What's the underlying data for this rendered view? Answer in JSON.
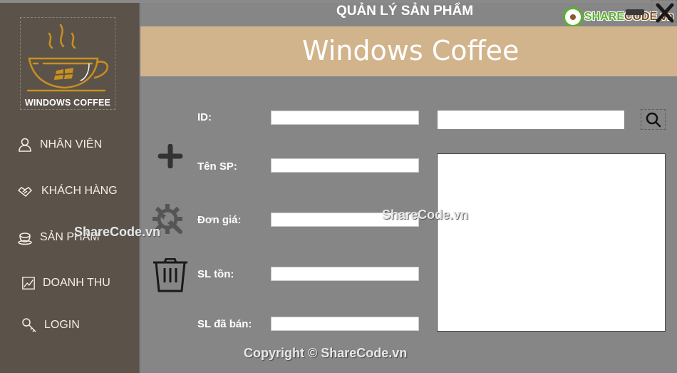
{
  "window": {
    "title": "QUẢN LÝ SẢN PHẨM",
    "minimize_icon": "minimize-icon",
    "close_icon": "close-icon"
  },
  "brand_watermark": {
    "share": "SHARE",
    "code": "CODE.vn"
  },
  "sidebar": {
    "logo_text": "WINDOWS COFFEE",
    "items": [
      {
        "label": "NHÂN VIÊN",
        "icon": "user-icon"
      },
      {
        "label": "KHÁCH HÀNG",
        "icon": "handshake-icon"
      },
      {
        "label": "SẢN PHẨM",
        "icon": "coffee-cup-icon"
      },
      {
        "label": "DOANH THU",
        "icon": "chart-icon"
      },
      {
        "label": "LOGIN",
        "icon": "key-icon"
      }
    ]
  },
  "banner": {
    "title": "Windows Coffee"
  },
  "form": {
    "fields": [
      {
        "label": "ID:",
        "value": ""
      },
      {
        "label": "Tên SP:",
        "value": ""
      },
      {
        "label": "Đơn giá:",
        "value": ""
      },
      {
        "label": "SL tồn:",
        "value": ""
      },
      {
        "label": "SL đã bán:",
        "value": ""
      }
    ],
    "actions": [
      {
        "name": "add",
        "icon": "plus-icon"
      },
      {
        "name": "edit",
        "icon": "settings-wrench-icon"
      },
      {
        "name": "delete",
        "icon": "trash-icon"
      }
    ]
  },
  "search": {
    "value": "",
    "icon": "search-icon"
  },
  "watermarks": [
    "ShareCode.vn",
    "ShareCode.vn"
  ],
  "footer": {
    "copyright": "Copyright © ShareCode.vn"
  }
}
